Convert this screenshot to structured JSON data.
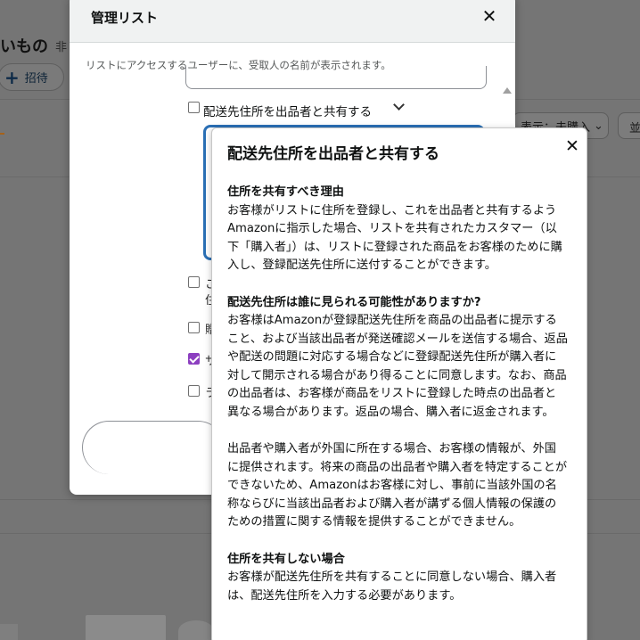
{
  "background": {
    "list_title": "いもの",
    "list_badge": "非",
    "invite_label": "招待",
    "filter_label": "表示：未購入",
    "sort_label": "並"
  },
  "modal": {
    "title": "管理リスト",
    "subtitle": "リストにアクセスするユーザーに、受取人の名前が表示されます。",
    "share_address_label": "配送先住所を出品者と共有する",
    "option_fragments": [
      "こ",
      "住",
      "贈",
      "サ",
      "ラ"
    ],
    "options": [
      {
        "checked": false
      },
      {
        "checked": false
      },
      {
        "checked": true
      },
      {
        "checked": false
      }
    ]
  },
  "popover": {
    "title": "配送先住所を出品者と共有する",
    "sections": [
      {
        "heading": "住所を共有すべき理由",
        "body": "お客様がリストに住所を登録し、これを出品者と共有するようAmazonに指示した場合、リストを共有されたカスタマー（以下「購入者」）は、リストに登録された商品をお客様のために購入し、登録配送先住所に送付することができます。"
      },
      {
        "heading": "配送先住所は誰に見られる可能性がありますか?",
        "body": "お客様はAmazonが登録配送先住所を商品の出品者に提示すること、および当該出品者が発送確認メールを送信する場合、返品や配送の問題に対応する場合などに登録配送先住所が購入者に対して開示される場合があり得ることに同意します。なお、商品の出品者は、お客様が商品をリストに登録した時点の出品者と異なる場合があります。返品の場合、購入者に返金されます。"
      },
      {
        "heading": "",
        "body": "出品者や購入者が外国に所在する場合、お客様の情報が、外国に提供されます。将来の商品の出品者や購入者を特定することができないため、Amazonはお客様に対し、事前に当該外国の名称ならびに当該出品者および購入者が講ずる個人情報の保護のための措置に関する情報を提供することができません。"
      },
      {
        "heading": "住所を共有しない場合",
        "body": "お客様が配送先住所を共有することに同意しない場合、購入者は、配送先住所を入力する必要があります。"
      }
    ]
  }
}
